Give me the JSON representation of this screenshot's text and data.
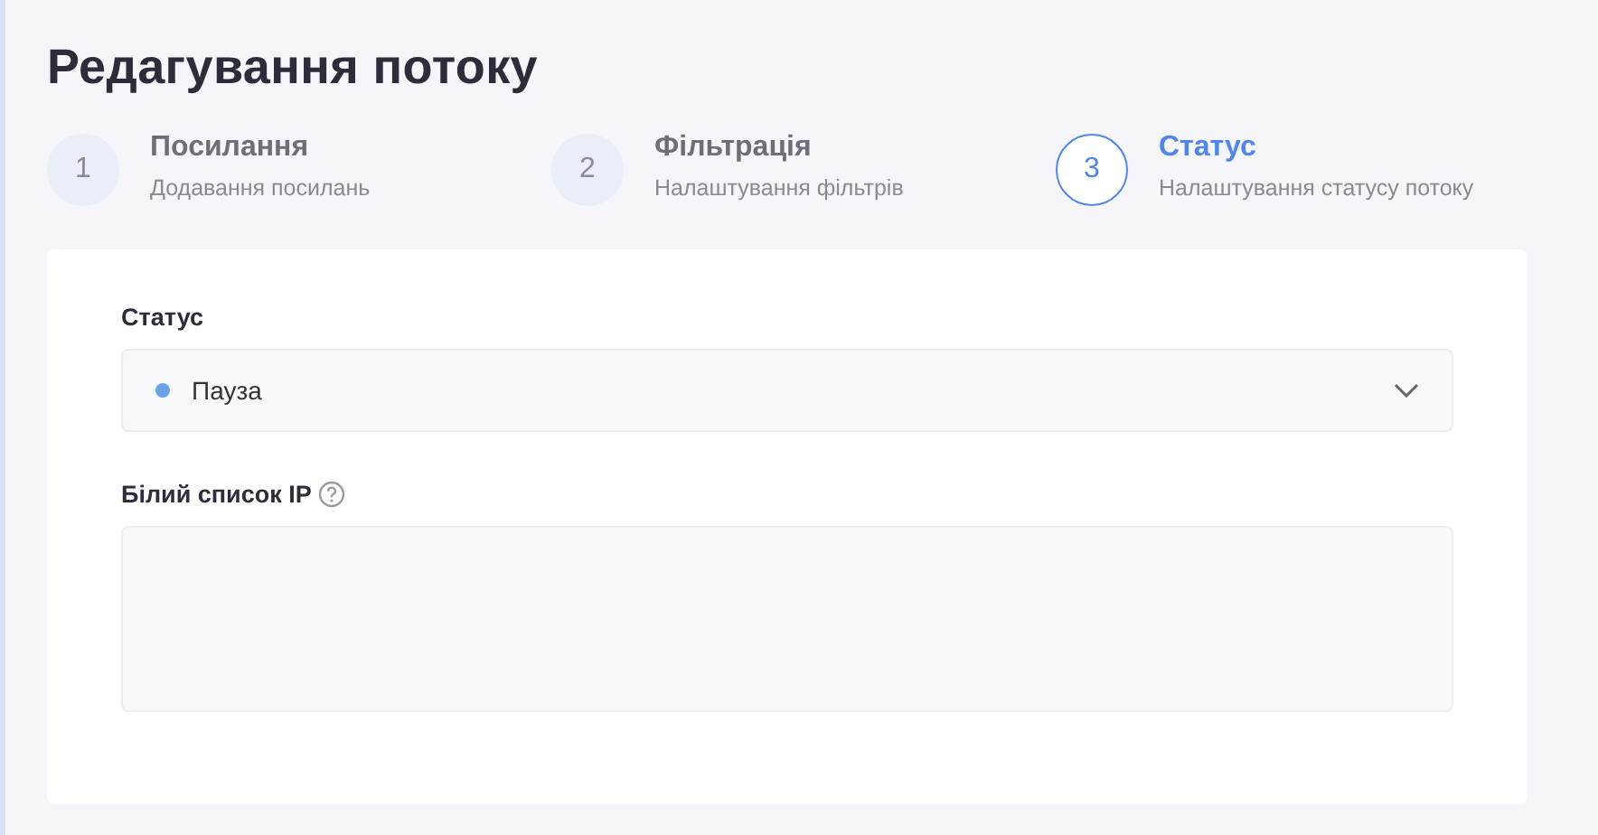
{
  "title": "Редагування потоку",
  "steps": [
    {
      "number": "1",
      "title": "Посилання",
      "subtitle": "Додавання посилань",
      "selected": false
    },
    {
      "number": "2",
      "title": "Фільтрація",
      "subtitle": "Налаштування фільтрів",
      "selected": false
    },
    {
      "number": "3",
      "title": "Статус",
      "subtitle": "Налаштування статусу потоку",
      "selected": true
    }
  ],
  "status": {
    "label": "Статус",
    "value": "Пауза",
    "color": "#6aa3ea"
  },
  "whitelist": {
    "label": "Білий список IP"
  }
}
